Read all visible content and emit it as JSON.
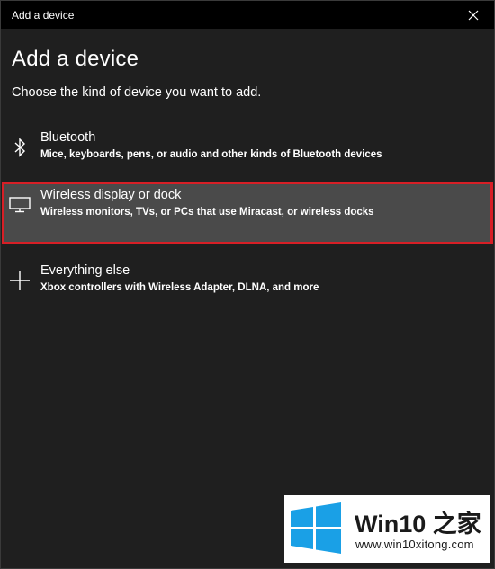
{
  "window": {
    "title": "Add a device"
  },
  "page": {
    "heading": "Add a device",
    "subheading": "Choose the kind of device you want to add."
  },
  "options": [
    {
      "icon": "bluetooth-icon",
      "title": "Bluetooth",
      "description": "Mice, keyboards, pens, or audio and other kinds of Bluetooth devices",
      "selected": false
    },
    {
      "icon": "monitor-icon",
      "title": "Wireless display or dock",
      "description": "Wireless monitors, TVs, or PCs that use Miracast, or wireless docks",
      "selected": true
    },
    {
      "icon": "plus-icon",
      "title": "Everything else",
      "description": "Xbox controllers with Wireless Adapter, DLNA, and more",
      "selected": false
    }
  ],
  "watermark": {
    "brand": "Win10 之家",
    "url": "www.win10xitong.com"
  },
  "colors": {
    "background": "#1f1f1f",
    "titlebar": "#000000",
    "selected_bg": "#4a4a4a",
    "selected_border": "#d71f26",
    "logo_blue": "#1aa0e6"
  }
}
